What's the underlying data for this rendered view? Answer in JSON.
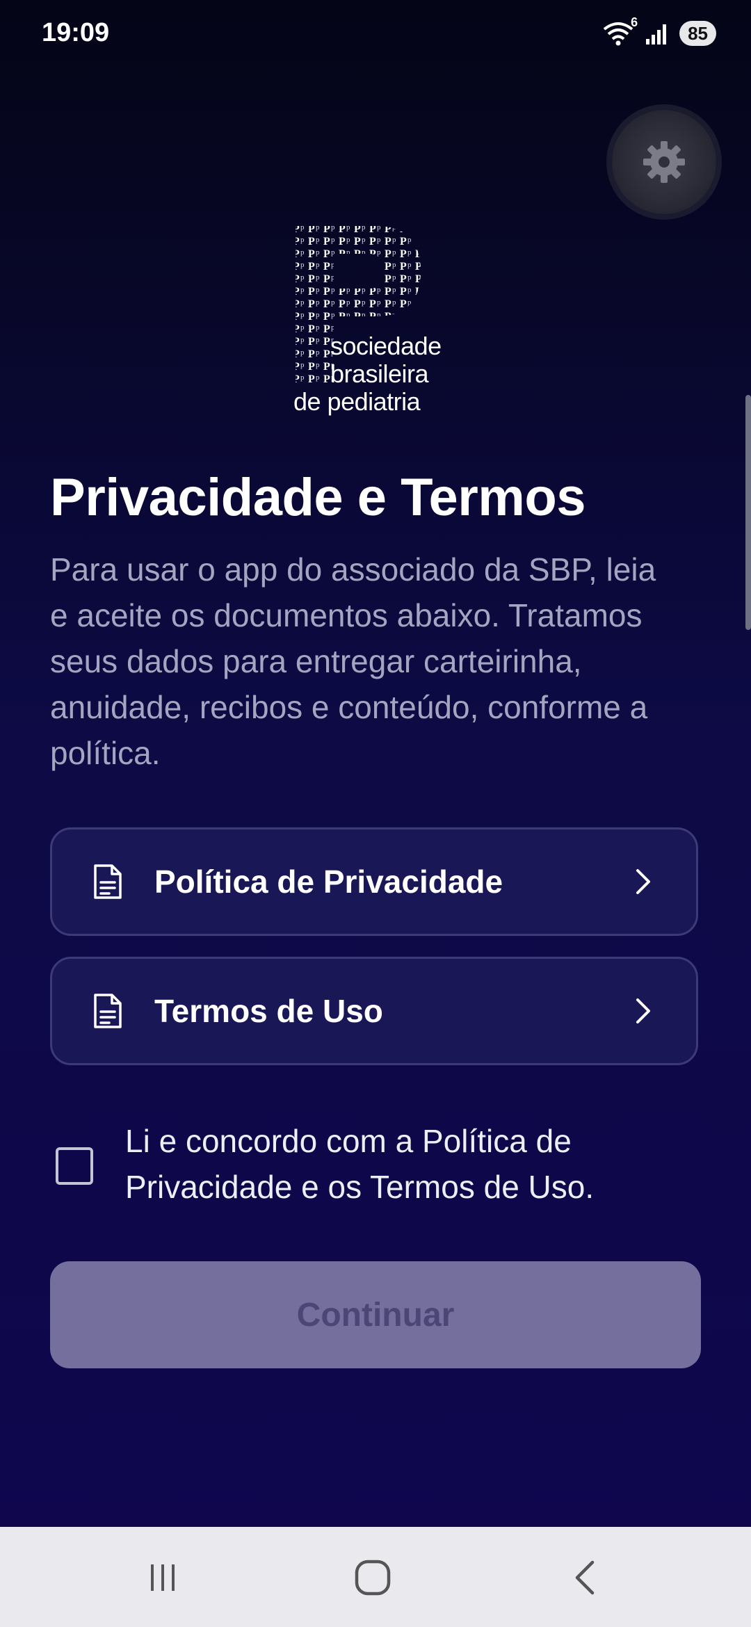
{
  "status_bar": {
    "time": "19:09",
    "battery": "85",
    "wifi_badge": "6",
    "icons": [
      "wifi-icon",
      "signal-icon",
      "battery-icon"
    ]
  },
  "logo": {
    "line1": "sociedade",
    "line2": "brasileira",
    "line3": "de pediatria"
  },
  "header": {
    "title": "Privacidade e Termos",
    "description": "Para usar o app do associado da SBP, leia e aceite os documentos abaixo. Tratamos seus dados para entregar carteirinha, anuidade, recibos e conteúdo, conforme a política."
  },
  "documents": [
    {
      "label": "Política de Privacidade",
      "icon": "document-icon"
    },
    {
      "label": "Termos de Uso",
      "icon": "document-icon"
    }
  ],
  "consent": {
    "text": "Li e concordo com a Política de Privacidade e os Termos de Uso.",
    "checked": false
  },
  "actions": {
    "continue_label": "Continuar"
  },
  "colors": {
    "background_top": "#040516",
    "background_bottom": "#0f064f",
    "card_bg": "#1a1757",
    "card_border": "#3c3a78",
    "button_disabled": "#746f9d",
    "desc_text": "#a3a5c1"
  },
  "nav": {
    "icons": [
      "recent-apps-icon",
      "home-icon",
      "back-icon"
    ]
  }
}
